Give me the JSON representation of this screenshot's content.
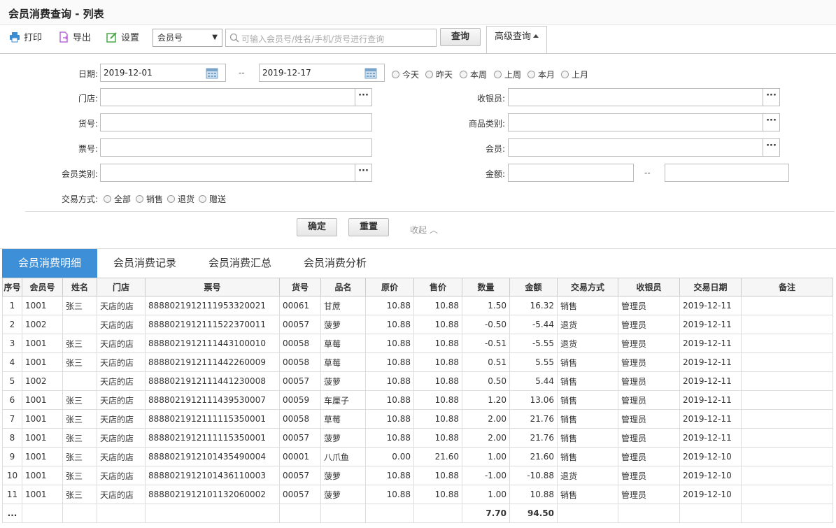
{
  "title": "会员消费查询 - 列表",
  "toolbar": {
    "print": "打印",
    "export": "导出",
    "settings": "设置",
    "search_field": "会员号",
    "search_placeholder": "可输入会员号/姓名/手机/货号进行查询",
    "query": "查询",
    "advanced": "高级查询"
  },
  "filters": {
    "date_label": "日期:",
    "date_from": "2019-12-01",
    "date_to": "2019-12-17",
    "date_sep": "--",
    "quick_dates": [
      "今天",
      "昨天",
      "本周",
      "上周",
      "本月",
      "上月"
    ],
    "store_label": "门店:",
    "cashier_label": "收银员:",
    "sku_label": "货号:",
    "category_label": "商品类别:",
    "ticket_label": "票号:",
    "member_label": "会员:",
    "member_type_label": "会员类别:",
    "amount_label": "金额:",
    "amount_sep": "--",
    "trade_label": "交易方式:",
    "trade_options": [
      "全部",
      "销售",
      "退货",
      "赠送"
    ],
    "confirm": "确定",
    "reset": "重置",
    "collapse": "收起"
  },
  "tabs": [
    "会员消费明细",
    "会员消费记录",
    "会员消费汇总",
    "会员消费分析"
  ],
  "table": {
    "columns": [
      "序号",
      "会员号",
      "姓名",
      "门店",
      "票号",
      "货号",
      "品名",
      "原价",
      "售价",
      "数量",
      "金额",
      "交易方式",
      "收银员",
      "交易日期",
      "备注"
    ],
    "rows": [
      [
        "1",
        "1001",
        "张三",
        "天店的店",
        "888802191211195332​0021",
        "00061",
        "甘蔗",
        "10.88",
        "10.88",
        "1.50",
        "16.32",
        "销售",
        "管理员",
        "2019-12-11",
        ""
      ],
      [
        "2",
        "1002",
        "",
        "天店的店",
        "8888021912111522370011",
        "00057",
        "菠萝",
        "10.88",
        "10.88",
        "-0.50",
        "-5.44",
        "退货",
        "管理员",
        "2019-12-11",
        ""
      ],
      [
        "3",
        "1001",
        "张三",
        "天店的店",
        "8888021912111443100010",
        "00058",
        "草莓",
        "10.88",
        "10.88",
        "-0.51",
        "-5.55",
        "退货",
        "管理员",
        "2019-12-11",
        ""
      ],
      [
        "4",
        "1001",
        "张三",
        "天店的店",
        "8888021912111442260009",
        "00058",
        "草莓",
        "10.88",
        "10.88",
        "0.51",
        "5.55",
        "销售",
        "管理员",
        "2019-12-11",
        ""
      ],
      [
        "5",
        "1002",
        "",
        "天店的店",
        "8888021912111441230008",
        "00057",
        "菠萝",
        "10.88",
        "10.88",
        "0.50",
        "5.44",
        "销售",
        "管理员",
        "2019-12-11",
        ""
      ],
      [
        "6",
        "1001",
        "张三",
        "天店的店",
        "8888021912111439530007",
        "00059",
        "车厘子",
        "10.88",
        "10.88",
        "1.20",
        "13.06",
        "销售",
        "管理员",
        "2019-12-11",
        ""
      ],
      [
        "7",
        "1001",
        "张三",
        "天店的店",
        "8888021912111115350001",
        "00058",
        "草莓",
        "10.88",
        "10.88",
        "2.00",
        "21.76",
        "销售",
        "管理员",
        "2019-12-11",
        ""
      ],
      [
        "8",
        "1001",
        "张三",
        "天店的店",
        "8888021912111115350001",
        "00057",
        "菠萝",
        "10.88",
        "10.88",
        "2.00",
        "21.76",
        "销售",
        "管理员",
        "2019-12-11",
        ""
      ],
      [
        "9",
        "1001",
        "张三",
        "天店的店",
        "8888021912101435490004",
        "00001",
        "八爪鱼",
        "0.00",
        "21.60",
        "1.00",
        "21.60",
        "销售",
        "管理员",
        "2019-12-10",
        ""
      ],
      [
        "10",
        "1001",
        "张三",
        "天店的店",
        "8888021912101436110003",
        "00057",
        "菠萝",
        "10.88",
        "10.88",
        "-1.00",
        "-10.88",
        "退货",
        "管理员",
        "2019-12-10",
        ""
      ],
      [
        "11",
        "1001",
        "张三",
        "天店的店",
        "8888021912101132060002",
        "00057",
        "菠萝",
        "10.88",
        "10.88",
        "1.00",
        "10.88",
        "销售",
        "管理员",
        "2019-12-10",
        ""
      ]
    ],
    "footer": {
      "seq": "...",
      "qty_total": "7.70",
      "amount_total": "94.50"
    }
  },
  "colors": {
    "accent": "#3d8fd8",
    "print_icon": "#3a8dd1",
    "export_icon": "#b86ad6",
    "settings_icon": "#4aa84a"
  }
}
